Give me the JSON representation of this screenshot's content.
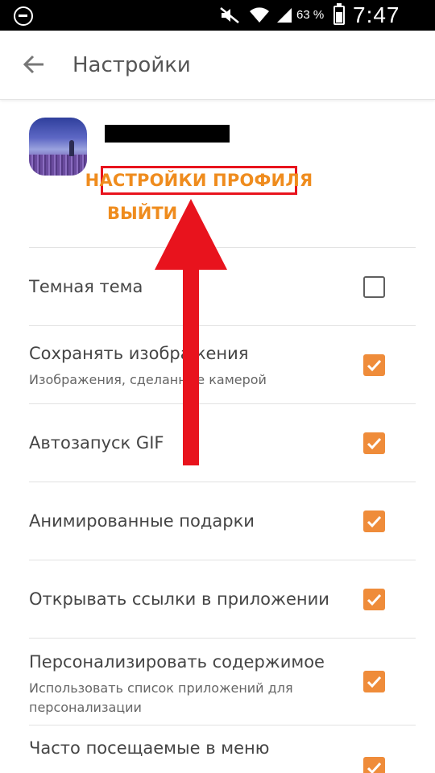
{
  "status_bar": {
    "battery_pct": "63 %",
    "time": "7:47 PM",
    "icons": [
      "minus-circle-icon",
      "mute-icon",
      "wifi-icon",
      "signal-icon",
      "battery-icon"
    ]
  },
  "toolbar": {
    "title": "Настройки",
    "back_icon": "arrow-left-icon"
  },
  "profile": {
    "settings_link": "НАСТРОЙКИ ПРОФИЛЯ",
    "logout_link": "ВЫЙТИ"
  },
  "settings": {
    "items": [
      {
        "title": "Темная тема",
        "subtitle": "",
        "checked": false
      },
      {
        "title": "Сохранять изображения",
        "subtitle": "Изображения, сделанные камерой",
        "checked": true
      },
      {
        "title": "Автозапуск GIF",
        "subtitle": "",
        "checked": true
      },
      {
        "title": "Анимированные подарки",
        "subtitle": "",
        "checked": true
      },
      {
        "title": "Открывать ссылки в приложении",
        "subtitle": "",
        "checked": true
      },
      {
        "title": "Персонализировать содержимое",
        "subtitle": "Использовать список приложений для персонализации",
        "checked": true
      },
      {
        "title": "Часто посещаемые в меню",
        "subtitle": "",
        "checked": true
      }
    ]
  },
  "colors": {
    "accent": "#ef8c3a",
    "link": "#ef8c1e",
    "annotation_red": "#e8131d",
    "status_bar": "#000000"
  }
}
